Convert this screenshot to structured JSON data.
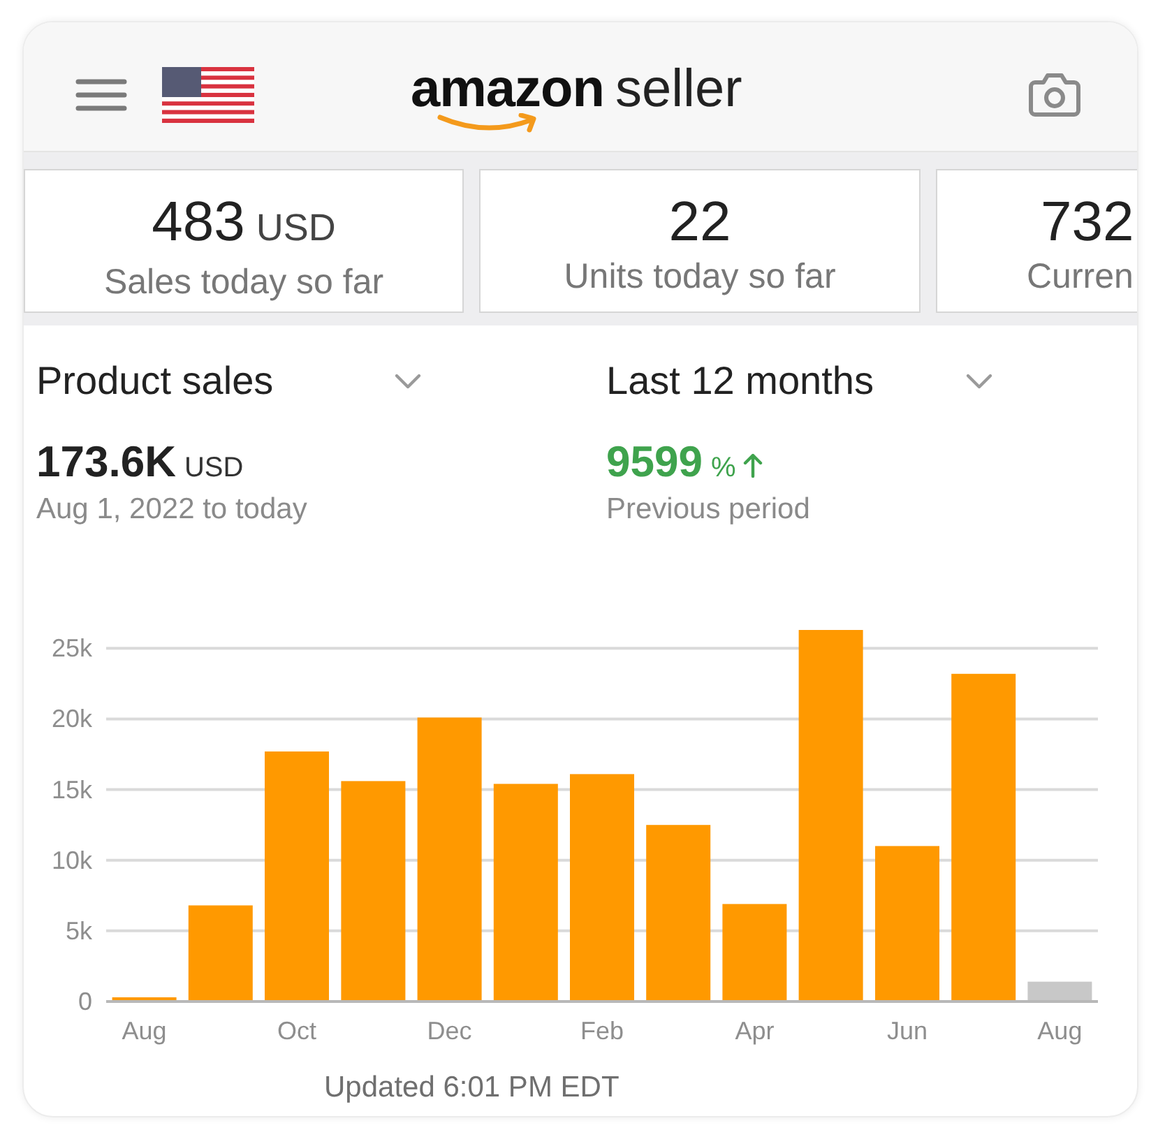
{
  "header": {
    "logo": {
      "brand": "amazon",
      "suffix": "seller"
    }
  },
  "stat_cards": [
    {
      "value": "483",
      "unit": "USD",
      "label": "Sales today so far"
    },
    {
      "value": "22",
      "label": "Units today so far"
    },
    {
      "value": "732",
      "label": "Curren"
    }
  ],
  "metric_dropdown": {
    "label": "Product sales"
  },
  "period_dropdown": {
    "label": "Last 12 months"
  },
  "total_sales": {
    "value": "173.6K",
    "unit": "USD",
    "caption": "Aug 1, 2022 to today"
  },
  "change": {
    "value": "9599",
    "unit": "%",
    "increase": true,
    "caption": "Previous period"
  },
  "chart": {
    "chart_data": {
      "type": "bar",
      "categories": [
        "Aug",
        null,
        "Oct",
        null,
        "Dec",
        null,
        "Feb",
        null,
        "Apr",
        null,
        "Jun",
        null,
        "Aug"
      ],
      "ylim": [
        0,
        26300
      ],
      "yticks": [
        {
          "value": 0,
          "label": "0"
        },
        {
          "value": 5000,
          "label": "5k"
        },
        {
          "value": 10000,
          "label": "10k"
        },
        {
          "value": 15000,
          "label": "15k"
        },
        {
          "value": 20000,
          "label": "20k"
        },
        {
          "value": 25000,
          "label": "25k"
        }
      ],
      "grid": true,
      "stacked": true,
      "series": [
        {
          "color": "#ff9900",
          "values": [
            300,
            6800,
            17700,
            15600,
            20100,
            15400,
            16100,
            12500,
            6900,
            26300,
            11000,
            23200,
            null
          ]
        },
        {
          "color": "#c8c8c8",
          "values": [
            null,
            null,
            null,
            null,
            null,
            null,
            null,
            null,
            null,
            null,
            null,
            null,
            1400
          ]
        }
      ]
    }
  },
  "footer": {
    "updated": "Updated 6:01 PM EDT"
  }
}
